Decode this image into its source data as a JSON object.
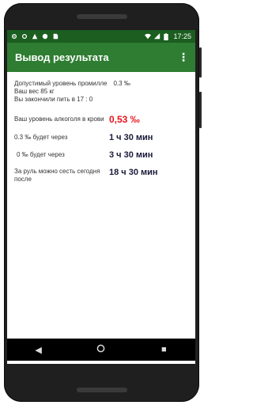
{
  "statusbar": {
    "time": "17:25"
  },
  "appbar": {
    "title": "Вывод результата"
  },
  "info": {
    "permille_label": "Допустимый уровень промилле",
    "permille_value": "0.3 ‰",
    "weight": "Ваш вес 85 кг",
    "finished": "Вы закончили пить в 17 : 0"
  },
  "results": [
    {
      "label": "Ваш уровень алкоголя в крови",
      "value": "0,53 ‰"
    },
    {
      "label": "0.3 ‰ будет через",
      "value": "1 ч 30 мин"
    },
    {
      "label": "0 ‰ будет через",
      "value": "3 ч 30 мин"
    },
    {
      "label": "За руль можно сесть сегодня после",
      "value": "18 ч 30 мин"
    }
  ],
  "colors": {
    "statusbar": "#1b5e20",
    "appbar": "#2e7d32",
    "highlight": "#e8131b"
  }
}
